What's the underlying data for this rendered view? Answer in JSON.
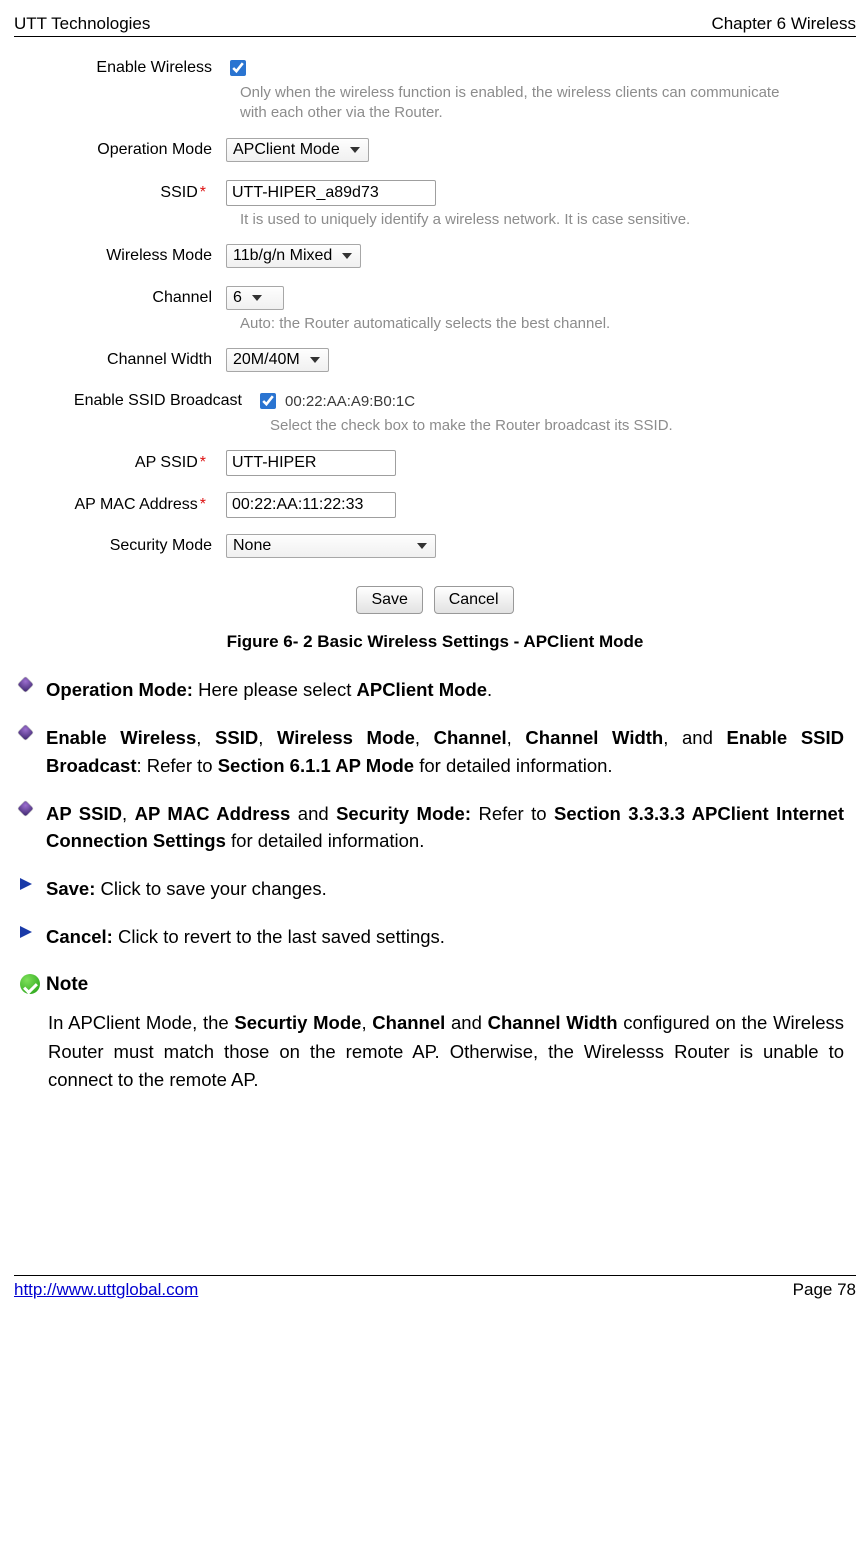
{
  "header": {
    "left": "UTT Technologies",
    "right": "Chapter 6 Wireless"
  },
  "form": {
    "enable_wireless": {
      "label": "Enable Wireless",
      "hint": "Only when the wireless function is enabled, the wireless clients can communicate with each other via the Router."
    },
    "operation_mode": {
      "label": "Operation Mode",
      "value": "APClient Mode"
    },
    "ssid": {
      "label": "SSID",
      "value": "UTT-HIPER_a89d73",
      "hint": "It is used to uniquely identify a wireless network. It is case sensitive."
    },
    "wireless_mode": {
      "label": "Wireless Mode",
      "value": "11b/g/n Mixed"
    },
    "channel": {
      "label": "Channel",
      "value": "6",
      "hint": "Auto: the Router automatically selects the best channel."
    },
    "channel_width": {
      "label": "Channel Width",
      "value": "20M/40M"
    },
    "enable_ssid_broadcast": {
      "label": "Enable SSID Broadcast",
      "mac": "00:22:AA:A9:B0:1C",
      "hint": "Select the check box to make the Router broadcast its SSID."
    },
    "ap_ssid": {
      "label": "AP SSID",
      "value": "UTT-HIPER"
    },
    "ap_mac": {
      "label": "AP MAC Address",
      "value": "00:22:AA:11:22:33"
    },
    "security_mode": {
      "label": "Security Mode",
      "value": "None"
    },
    "buttons": {
      "save": "Save",
      "cancel": "Cancel"
    }
  },
  "caption": "Figure 6- 2 Basic Wireless Settings - APClient Mode",
  "bullets": {
    "b1_pre": "Operation Mode: ",
    "b1_mid": "Here please select ",
    "b1_bold": "APClient Mode",
    "b1_post": ".",
    "b2a": "Enable Wireless",
    "b2b": "SSID",
    "b2c": "Wireless Mode",
    "b2d": "Channel",
    "b2e": "Channel Width",
    "b2and": ", and ",
    "b2f": "Enable SSID Broadcast",
    "b2ref": ": Refer to ",
    "b2sec": "Section 6.1.1 AP Mode",
    "b2end": " for detailed information.",
    "b3a": "AP SSID",
    "b3b": "AP MAC Address",
    "b3and": " and ",
    "b3c": "Security Mode:",
    "b3ref": " Refer to ",
    "b3sec": "Section 3.3.3.3 APClient Internet Connection Settings",
    "b3end": " for detailed information.",
    "b4_bold": "Save:",
    "b4_rest": " Click to save your changes.",
    "b5_bold": "Cancel:",
    "b5_rest": " Click to revert to the last saved settings."
  },
  "note": {
    "head": "Note",
    "p1a": "In APClient Mode, the ",
    "p1b": "Securtiy Mode",
    "p1c": ", ",
    "p1d": "Channel",
    "p1e": " and ",
    "p1f": "Channel Width",
    "p1g": " configured on the Wireless Router must match those on the remote AP. Otherwise, the Wirelesss Router is unable to connect to the remote AP."
  },
  "footer": {
    "url": "http://www.uttglobal.com",
    "page": "Page 78"
  }
}
